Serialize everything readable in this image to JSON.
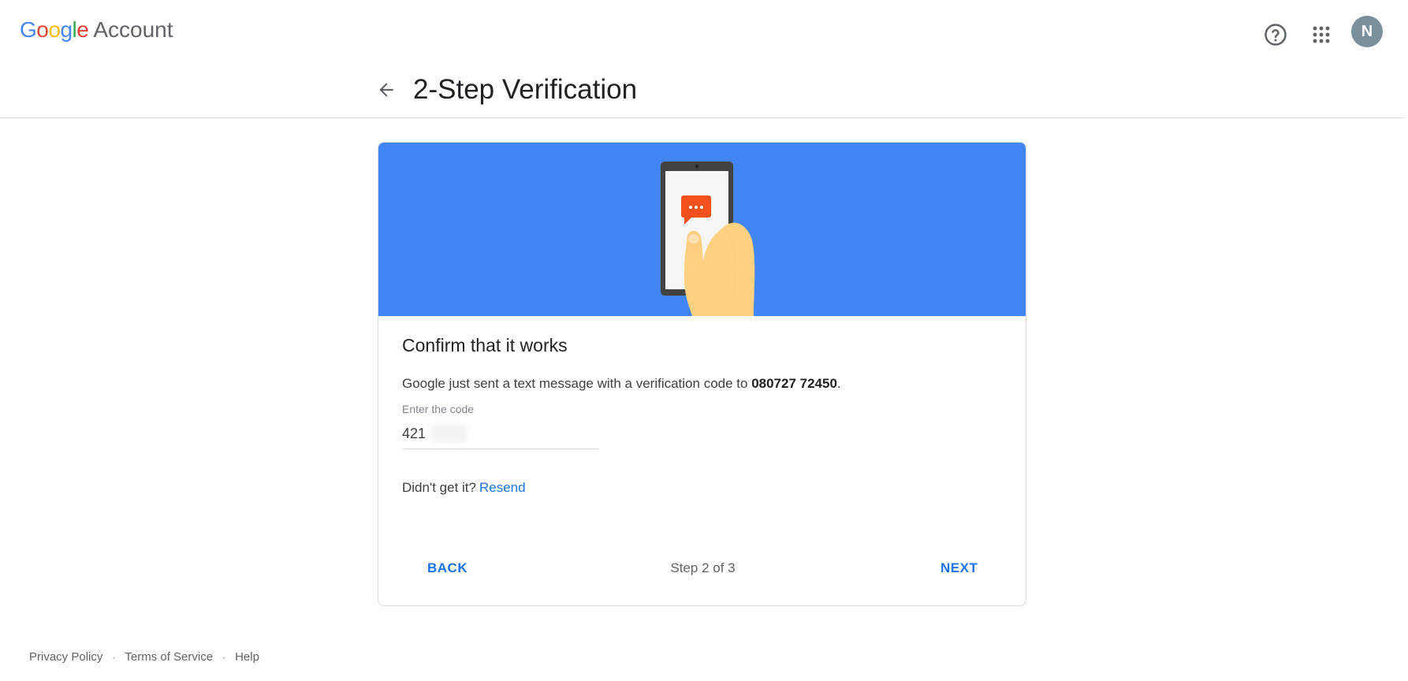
{
  "app": {
    "logo_letters": [
      "G",
      "o",
      "o",
      "g",
      "l",
      "e"
    ],
    "logo_suffix": "Account"
  },
  "topbar": {
    "help_icon": "help-circle-icon",
    "apps_icon": "apps-grid-icon",
    "avatar_initial": "N",
    "avatar_color": "#78909c"
  },
  "header": {
    "back_icon": "arrow-back-icon",
    "title": "2-Step Verification"
  },
  "card": {
    "banner_color": "#4285f4",
    "banner_icon": "phone-message-illustration",
    "title": "Confirm that it works",
    "message_prefix": "Google just sent a text message with a verification code to ",
    "phone_number": "080727 72450",
    "message_suffix": ".",
    "code_label": "Enter the code",
    "code_value": "421",
    "resend_prompt": "Didn't get it?",
    "resend_link": "Resend",
    "back_button": "BACK",
    "step_text": "Step 2 of 3",
    "next_button": "NEXT"
  },
  "footer": {
    "privacy": "Privacy Policy",
    "terms": "Terms of Service",
    "help": "Help",
    "separator": "·"
  },
  "colors": {
    "accent": "#1a73e8",
    "google_blue": "#4285f4",
    "google_red": "#ea4335",
    "google_yellow": "#fbbc05",
    "google_green": "#34a853"
  }
}
